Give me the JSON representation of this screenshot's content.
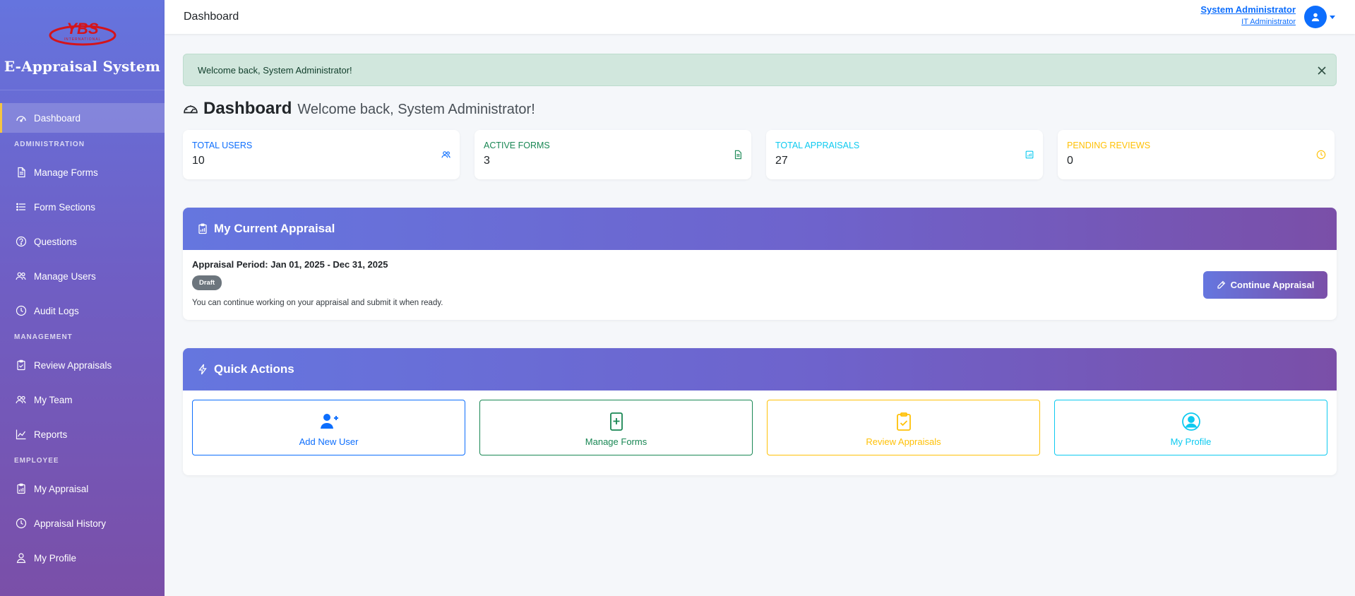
{
  "brand": {
    "logo_text": "YBS",
    "logo_subtext": "INTERNATIONAL",
    "title": "E-Appraisal System"
  },
  "sidebar": {
    "items": [
      {
        "label": "Dashboard",
        "icon": "dashboard-gauge-icon",
        "active": true
      },
      {
        "section": "ADMINISTRATION"
      },
      {
        "label": "Manage Forms",
        "icon": "file-icon"
      },
      {
        "label": "Form Sections",
        "icon": "list-icon"
      },
      {
        "label": "Questions",
        "icon": "question-circle-icon"
      },
      {
        "label": "Manage Users",
        "icon": "users-icon"
      },
      {
        "label": "Audit Logs",
        "icon": "clock-icon"
      },
      {
        "section": "MANAGEMENT"
      },
      {
        "label": "Review Appraisals",
        "icon": "clipboard-check-icon"
      },
      {
        "label": "My Team",
        "icon": "users-icon"
      },
      {
        "label": "Reports",
        "icon": "chart-line-icon"
      },
      {
        "section": "EMPLOYEE"
      },
      {
        "label": "My Appraisal",
        "icon": "clipboard-icon"
      },
      {
        "label": "Appraisal History",
        "icon": "history-icon"
      },
      {
        "label": "My Profile",
        "icon": "person-icon"
      }
    ]
  },
  "header": {
    "title": "Dashboard",
    "user_name": "System Administrator",
    "user_role": "IT Administrator"
  },
  "alert": {
    "text": "Welcome back, System Administrator!"
  },
  "page": {
    "title": "Dashboard",
    "subtitle": "Welcome back, System Administrator!"
  },
  "stats": [
    {
      "label": "TOTAL USERS",
      "value": "10",
      "color": "#0d6efd",
      "icon": "users-icon"
    },
    {
      "label": "ACTIVE FORMS",
      "value": "3",
      "color": "#198754",
      "icon": "file-icon"
    },
    {
      "label": "TOTAL APPRAISALS",
      "value": "27",
      "color": "#0dcaf0",
      "icon": "clipboard-data-icon"
    },
    {
      "label": "PENDING REVIEWS",
      "value": "0",
      "color": "#ffc107",
      "icon": "clock-icon"
    }
  ],
  "current_appraisal": {
    "title": "My Current Appraisal",
    "period": "Appraisal Period: Jan 01, 2025 - Dec 31, 2025",
    "status": "Draft",
    "hint": "You can continue working on your appraisal and submit it when ready.",
    "button": "Continue Appraisal"
  },
  "quick_actions": {
    "title": "Quick Actions",
    "items": [
      {
        "label": "Add New User",
        "color": "#0d6efd",
        "icon": "person-plus-icon"
      },
      {
        "label": "Manage Forms",
        "color": "#198754",
        "icon": "file-plus-icon"
      },
      {
        "label": "Review Appraisals",
        "color": "#ffc107",
        "icon": "clipboard-check-icon"
      },
      {
        "label": "My Profile",
        "color": "#0dcaf0",
        "icon": "person-circle-icon"
      }
    ]
  },
  "colors": {
    "primary": "#0d6efd",
    "gradient_start": "#6576df",
    "gradient_end": "#7a4fa8",
    "accent": "#f5c542"
  }
}
